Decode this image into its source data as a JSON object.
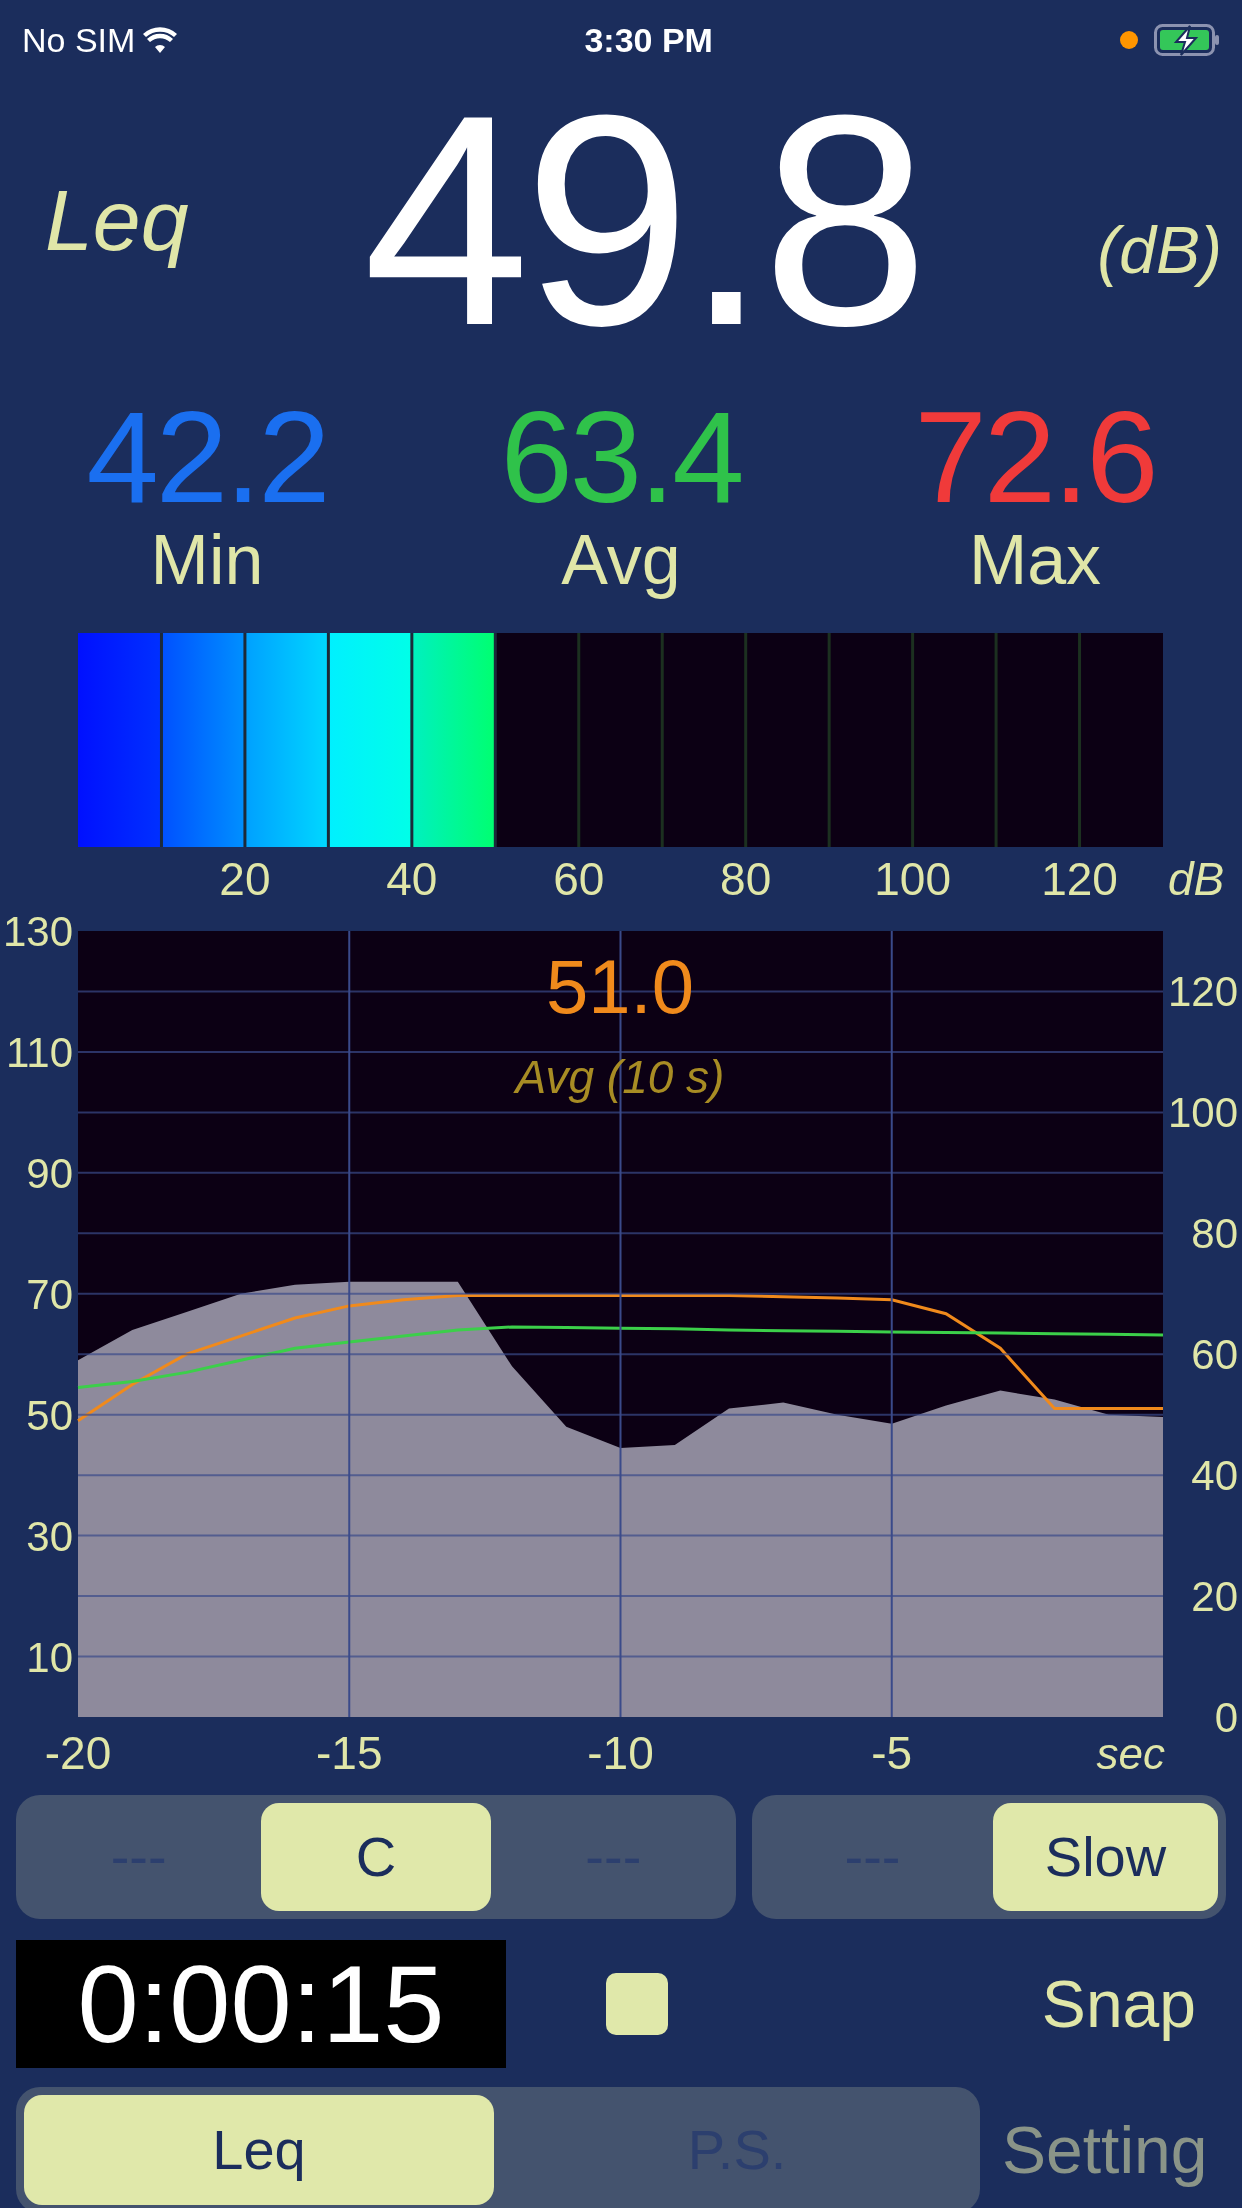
{
  "status_bar": {
    "carrier": "No SIM",
    "time": "3:30 PM"
  },
  "header": {
    "mode": "Leq",
    "value": "49.8",
    "unit": "(dB)"
  },
  "stats": [
    {
      "value": "42.2",
      "label": "Min",
      "color": "#1a6ff0"
    },
    {
      "value": "63.4",
      "label": "Avg",
      "color": "#2fc24a"
    },
    {
      "value": "72.6",
      "label": "Max",
      "color": "#f03a3a"
    }
  ],
  "meter": {
    "level": 0.385,
    "scale": [
      "20",
      "40",
      "60",
      "80",
      "100",
      "120"
    ],
    "unit": "dB"
  },
  "chart": {
    "right_axis_labels": [
      "120",
      "100",
      "80",
      "60",
      "40",
      "20",
      "0"
    ],
    "overlay_value": "51.0",
    "overlay_label": "Avg (10 s)",
    "chart_data": {
      "type": "area",
      "xlabel": "sec",
      "x": [
        -20,
        -19,
        -18,
        -17,
        -16,
        -15,
        -14,
        -13,
        -12,
        -11,
        -10,
        -9,
        -8,
        -7,
        -6,
        -5,
        -4,
        -3,
        -2,
        -1,
        0
      ],
      "grid": true,
      "xlim": [
        -20,
        0
      ],
      "ylim": [
        0,
        130
      ],
      "xticks": [
        -20,
        -15,
        -10,
        -5
      ],
      "yticks": [
        10,
        30,
        50,
        70,
        90,
        110,
        130
      ],
      "series": [
        {
          "type": "area",
          "color": "#8e8a9c",
          "values": [
            59,
            64,
            67,
            70,
            71.5,
            72,
            72,
            72,
            58,
            48,
            44.5,
            45,
            51,
            52,
            50,
            48.5,
            51.5,
            54,
            52.5,
            50,
            49.6
          ]
        },
        {
          "type": "line",
          "color": "#f08a1c",
          "values": [
            49,
            55,
            60,
            63,
            66,
            68,
            69,
            69.7,
            69.7,
            69.7,
            69.7,
            69.7,
            69.7,
            69.5,
            69.3,
            69,
            66.7,
            61,
            51,
            51,
            51
          ]
        },
        {
          "type": "line",
          "color": "#3ccf4a",
          "values": [
            54.5,
            55.5,
            57,
            59,
            61,
            62,
            63,
            64,
            64.5,
            64.4,
            64.3,
            64.2,
            64,
            63.9,
            63.8,
            63.7,
            63.6,
            63.5,
            63.4,
            63.3,
            63.2
          ]
        }
      ]
    }
  },
  "weighting": [
    {
      "label": "---",
      "selected": false
    },
    {
      "label": "C",
      "selected": true
    },
    {
      "label": "---",
      "selected": false
    }
  ],
  "response": [
    {
      "label": "---",
      "selected": false
    },
    {
      "label": "Slow",
      "selected": true
    }
  ],
  "timer": {
    "time": "0:00:15"
  },
  "snap": {
    "label": "Snap"
  },
  "tabs": [
    {
      "label": "Leq",
      "selected": true
    },
    {
      "label": "P.S.",
      "selected": false
    }
  ],
  "setting": {
    "label": "Setting",
    "disabled": true
  }
}
